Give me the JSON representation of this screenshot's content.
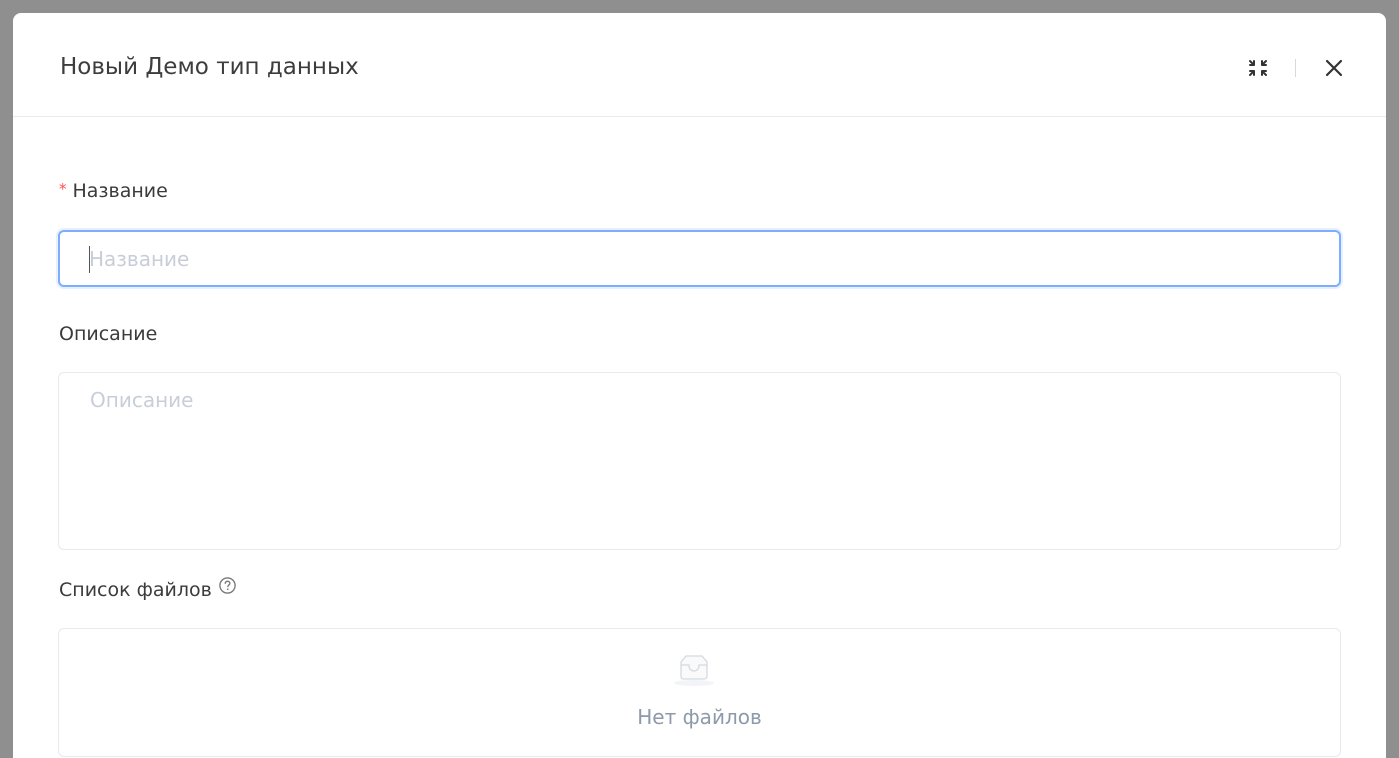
{
  "dialog": {
    "title": "Новый Демо тип данных",
    "actions": {
      "collapse_icon": "collapse-icon",
      "close_icon": "close-icon"
    }
  },
  "form": {
    "name": {
      "label": "Название",
      "required_mark": "*",
      "placeholder": "Название",
      "value": ""
    },
    "description": {
      "label": "Описание",
      "placeholder": "Описание",
      "value": ""
    },
    "files": {
      "label": "Список файлов",
      "help_icon": "question-circle-icon",
      "empty_icon": "inbox-icon",
      "empty_text": "Нет файлов"
    }
  },
  "colors": {
    "overlay": "#8f8f8f",
    "focus_border": "#7dadff",
    "required": "#ff4d4f",
    "muted_text": "#8d9aaa",
    "placeholder": "#c8ced8"
  }
}
